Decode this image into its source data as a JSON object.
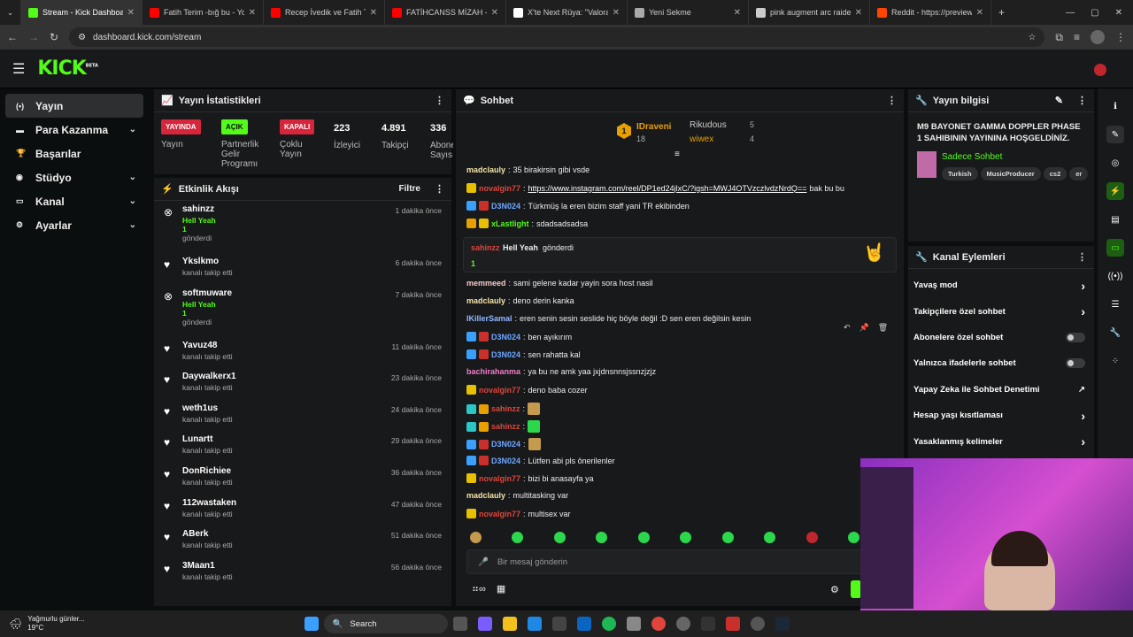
{
  "browser": {
    "tabs": [
      {
        "title": "Stream - Kick Dashboard",
        "color": "#53fc18",
        "active": true
      },
      {
        "title": "Fatih Terim -bığ bu - YouT",
        "color": "#ff0000"
      },
      {
        "title": "Recep İvedik ve Fatih Teri",
        "color": "#ff0000"
      },
      {
        "title": "FATİHCANSS MİZAH - JET",
        "color": "#ff0000"
      },
      {
        "title": "X'te Next Rüya: \"Valorant",
        "color": "#ffffff"
      },
      {
        "title": "Yeni Sekme",
        "color": "#aaaaaa"
      },
      {
        "title": "pink augment arc raiders",
        "color": "#cccccc"
      },
      {
        "title": "Reddit - https://preview.a",
        "color": "#ff4500"
      }
    ],
    "url": "dashboard.kick.com/stream"
  },
  "kick": {
    "logo": "KICK",
    "beta": "BETA"
  },
  "nav": {
    "items": [
      {
        "label": "Yayın",
        "icon": "stream-icon",
        "chev": false
      },
      {
        "label": "Para Kazanma",
        "icon": "money-icon",
        "chev": true
      },
      {
        "label": "Başarılar",
        "icon": "trophy-icon",
        "chev": false
      },
      {
        "label": "Stüdyo",
        "icon": "studio-icon",
        "chev": true
      },
      {
        "label": "Kanal",
        "icon": "channel-icon",
        "chev": true
      },
      {
        "label": "Ayarlar",
        "icon": "settings-icon",
        "chev": true
      }
    ]
  },
  "stats": {
    "title": "Yayın İstatistikleri",
    "live_badge": "YAYINDA",
    "live_label": "Yayın",
    "partner_badge": "AÇIK",
    "partner_label": "Partnerlik Gelir Programı",
    "multi_badge": "KAPALI",
    "multi_label": "Çoklu Yayın",
    "viewers": "223",
    "viewers_label": "İzleyici",
    "followers": "4.891",
    "followers_label": "Takipçi",
    "subs": "336",
    "subs_label": "Abone Sayısı"
  },
  "activity": {
    "title": "Etkinlik Akışı",
    "filter": "Filtre",
    "items": [
      {
        "name": "sahinzz",
        "type": "gift",
        "sub1": "Hell Yeah",
        "sub2": "1",
        "sub3": "gönderdi",
        "time": "1 dakika önce"
      },
      {
        "name": "Ykslkmo",
        "type": "follow",
        "sub1": "kanalı takip etti",
        "time": "6 dakika önce"
      },
      {
        "name": "softmuware",
        "type": "gift",
        "sub1": "Hell Yeah",
        "sub2": "1",
        "sub3": "gönderdi",
        "time": "7 dakika önce"
      },
      {
        "name": "Yavuz48",
        "type": "follow",
        "sub1": "kanalı takip etti",
        "time": "11 dakika önce"
      },
      {
        "name": "Daywalkerx1",
        "type": "follow",
        "sub1": "kanalı takip etti",
        "time": "23 dakika önce"
      },
      {
        "name": "weth1us",
        "type": "follow",
        "sub1": "kanalı takip etti",
        "time": "24 dakika önce"
      },
      {
        "name": "Lunartt",
        "type": "follow",
        "sub1": "kanalı takip etti",
        "time": "29 dakika önce"
      },
      {
        "name": "DonRichiee",
        "type": "follow",
        "sub1": "kanalı takip etti",
        "time": "36 dakika önce"
      },
      {
        "name": "112wastaken",
        "type": "follow",
        "sub1": "kanalı takip etti",
        "time": "47 dakika önce"
      },
      {
        "name": "ABerk",
        "type": "follow",
        "sub1": "kanalı takip etti",
        "time": "51 dakika önce"
      },
      {
        "name": "3Maan1",
        "type": "follow",
        "sub1": "kanalı takip etti",
        "time": "56 dakika önce"
      }
    ]
  },
  "chat": {
    "title": "Sohbet",
    "pinned": [
      {
        "rank": "1",
        "name": "IDraveni",
        "count": "18"
      },
      {
        "name": "Rikudous",
        "count": "5"
      },
      {
        "name": "wiwex",
        "count": "4"
      }
    ],
    "messages": [
      {
        "user": "madclauly",
        "color": "#f5e6a8",
        "text": "35 birakirsin gibi vsde",
        "badges": []
      },
      {
        "user": "novalgin77",
        "color": "#e0453b",
        "text": "https://www.instagram.com/reel/DP1ed24jlxC/?igsh=MWJ4OTVzczlvdzNrdQ==",
        "suffix": " bak bu bu",
        "badges": [
          "#e8c000"
        ]
      },
      {
        "user": "D3N024",
        "color": "#6fa8ff",
        "text": "Türkmüş la eren bizim staff yani TR ekibinden",
        "badges": [
          "#3aa0ff",
          "#c9302c"
        ]
      },
      {
        "user": "xLastlight",
        "color": "#53fc18",
        "text": "sdadsadsadsa",
        "badges": [
          "#e8a000",
          "#e8c000"
        ]
      },
      {
        "user": "memmeed",
        "color": "#f3c9c9",
        "text": "sami gelene kadar yayin sora host nasil",
        "badges": []
      },
      {
        "user": "madclauly",
        "color": "#f5e6a8",
        "text": "deno derin kanka",
        "badges": []
      },
      {
        "user": "IKillerSamal",
        "color": "#8fb8ff",
        "text": "eren senin sesin seslide hiç böyle değil :D sen eren değilsin kesin",
        "badges": []
      },
      {
        "user": "D3N024",
        "color": "#6fa8ff",
        "text": "ben ayıkırım",
        "badges": [
          "#3aa0ff",
          "#c9302c"
        ]
      },
      {
        "user": "D3N024",
        "color": "#6fa8ff",
        "text": "sen rahatta kal",
        "badges": [
          "#3aa0ff",
          "#c9302c"
        ]
      },
      {
        "user": "bachirahanma",
        "color": "#f07fc8",
        "text": "ya bu ne amk yaa jxjdnsnnsjssnzjzjz",
        "badges": []
      },
      {
        "user": "novalgin77",
        "color": "#e0453b",
        "text": "deno baba cozer",
        "badges": [
          "#e8c000"
        ]
      },
      {
        "user": "sahinzz",
        "color": "#e0453b",
        "text": "",
        "badges": [
          "#2bc7c7",
          "#e8a000"
        ],
        "emote": "#c49a4c"
      },
      {
        "user": "sahinzz",
        "color": "#e0453b",
        "text": "",
        "badges": [
          "#2bc7c7",
          "#e8a000"
        ],
        "emote": "#2bd84b"
      },
      {
        "user": "D3N024",
        "color": "#6fa8ff",
        "text": "",
        "badges": [
          "#3aa0ff",
          "#c9302c"
        ],
        "emote": "#c49a4c"
      },
      {
        "user": "D3N024",
        "color": "#6fa8ff",
        "text": "Lütfen abi pls önerilenler",
        "badges": [
          "#3aa0ff",
          "#c9302c"
        ]
      },
      {
        "user": "novalgin77",
        "color": "#e0453b",
        "text": "bizi bi anasayfa ya",
        "badges": [
          "#e8c000"
        ]
      },
      {
        "user": "madclauly",
        "color": "#f5e6a8",
        "text": "multitasking var",
        "badges": []
      },
      {
        "user": "novalgin77",
        "color": "#e0453b",
        "text": "multisex var",
        "badges": [
          "#e8c000"
        ]
      }
    ],
    "gift": {
      "user": "sahinzz",
      "item": "Hell Yeah",
      "verb": "gönderdi",
      "count": "1"
    },
    "input_placeholder": "Bir mesaj gönderin"
  },
  "info": {
    "title": "Yayın bilgisi",
    "stream_title": "M9 BAYONET GAMMA DOPPLER PHASE 1 SAHIBININ YAYININA HOŞGELDİNİZ.",
    "category": "Sadece Sohbet",
    "tags": [
      "Turkish",
      "MusicProducer",
      "cs2",
      "er"
    ]
  },
  "actions": {
    "title": "Kanal Eylemleri",
    "items": [
      {
        "label": "Yavaş mod",
        "kind": "chev"
      },
      {
        "label": "Takipçilere özel sohbet",
        "kind": "chev"
      },
      {
        "label": "Abonelere özel sohbet",
        "kind": "toggle"
      },
      {
        "label": "Yalnızca ifadelerle sohbet",
        "kind": "toggle"
      },
      {
        "label": "Yapay Zeka ile Sohbet Denetimi",
        "kind": "ext"
      },
      {
        "label": "Hesap yaşı kısıtlaması",
        "kind": "chev"
      },
      {
        "label": "Yasaklanmış kelimeler",
        "kind": "chev"
      }
    ]
  },
  "taskbar": {
    "weather_title": "Yağmurlu günler...",
    "weather_temp": "19°C",
    "search": "Search"
  }
}
